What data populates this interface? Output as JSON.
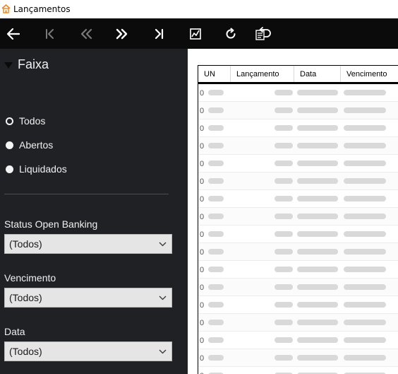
{
  "window": {
    "title": "Lançamentos",
    "app_icon": "app-house-icon",
    "accent_color": "#e8861a"
  },
  "toolbar": {
    "buttons": [
      {
        "name": "back",
        "icon": "arrow-left-icon"
      },
      {
        "name": "first",
        "icon": "skip-first-icon",
        "disabled": true
      },
      {
        "name": "previous",
        "icon": "double-chevron-left-icon",
        "disabled": true
      },
      {
        "name": "next",
        "icon": "double-chevron-right-icon"
      },
      {
        "name": "last",
        "icon": "skip-last-icon"
      },
      {
        "name": "chart",
        "icon": "chart-icon"
      },
      {
        "name": "refresh",
        "icon": "refresh-icon"
      },
      {
        "name": "undo-report",
        "icon": "document-undo-icon"
      }
    ]
  },
  "sidebar": {
    "section_title": "Faixa",
    "radios": [
      {
        "label": "Todos",
        "selected": true
      },
      {
        "label": "Abertos",
        "selected": false
      },
      {
        "label": "Liquidados",
        "selected": false
      }
    ],
    "filters": [
      {
        "label": "Status Open Banking",
        "value": "(Todos)"
      },
      {
        "label": "Vencimento",
        "value": "(Todos)"
      },
      {
        "label": "Data",
        "value": "(Todos)"
      }
    ]
  },
  "grid": {
    "columns": [
      "UN",
      "Lançamento",
      "Data",
      "Vencimento"
    ],
    "row_stub": "0",
    "row_count": 17
  }
}
